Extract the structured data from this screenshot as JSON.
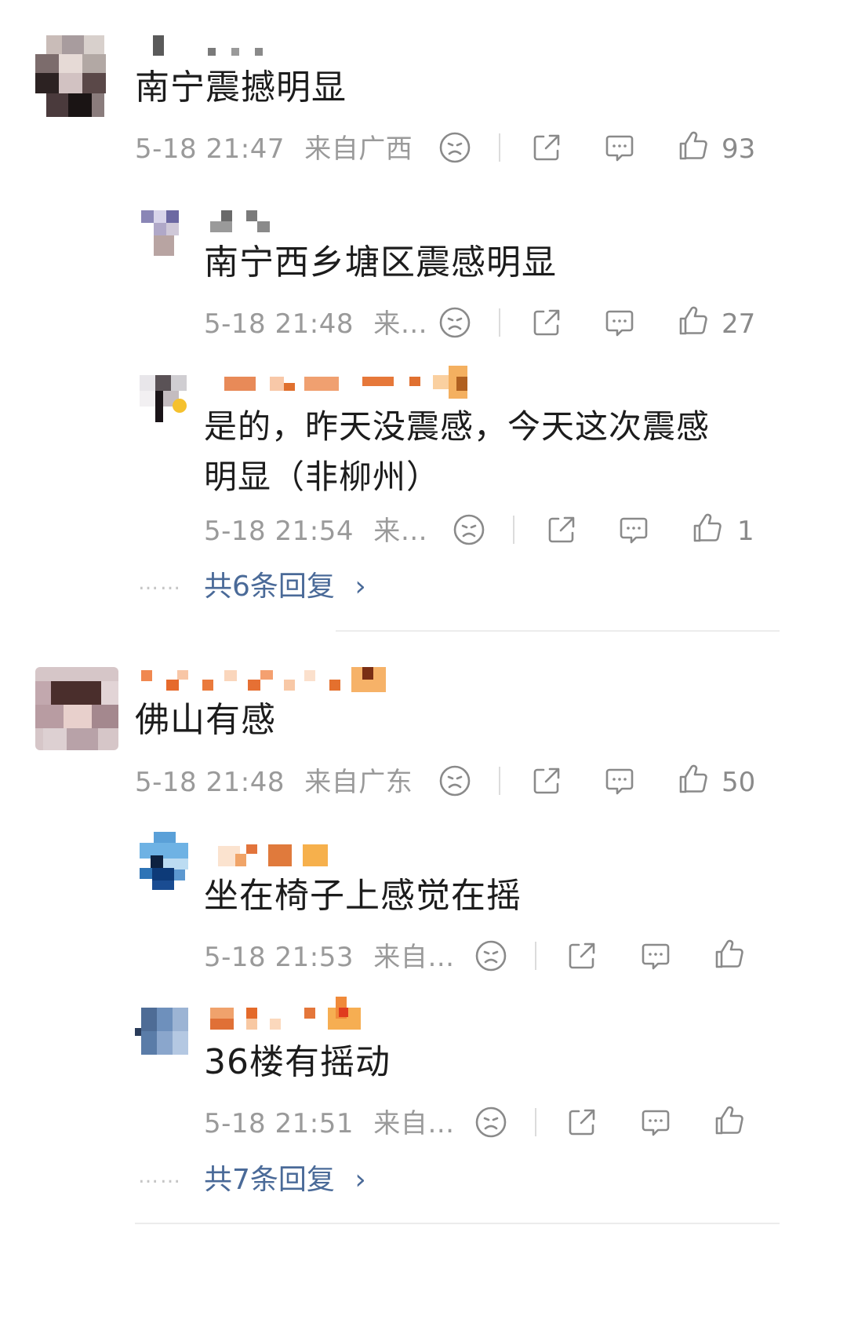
{
  "comments": [
    {
      "text": "南宁震撼明显",
      "time": "5-18 21:47",
      "location": "来自广西",
      "likes": "93",
      "replies": [
        {
          "text": "南宁西乡塘区震感明显",
          "time": "5-18 21:48",
          "location": "来…",
          "likes": "27"
        },
        {
          "text": "是的，昨天没震感，今天这次震感明显（非柳州）",
          "time": "5-18 21:54",
          "location": "来…",
          "likes": "1"
        }
      ],
      "more_dots": "……",
      "more_replies": "共6条回复",
      "more_arrow": "›"
    },
    {
      "text": "佛山有感",
      "time": "5-18 21:48",
      "location": "来自广东",
      "likes": "50",
      "replies": [
        {
          "text": "坐在椅子上感觉在摇",
          "time": "5-18 21:53",
          "location": "来自…",
          "likes": ""
        },
        {
          "text": "36楼有摇动",
          "time": "5-18 21:51",
          "location": "来自…",
          "likes": ""
        }
      ],
      "more_dots": "……",
      "more_replies": "共7条回复",
      "more_arrow": "›"
    }
  ],
  "icons": [
    "dislike-icon",
    "share-icon",
    "comment-icon",
    "like-icon",
    "chevron-right-icon"
  ],
  "colors": {
    "text": "#1c1c1c",
    "meta": "#9a9a9a",
    "icon": "#8a8a8a",
    "link": "#4a6a98",
    "background": "#ffffff"
  }
}
